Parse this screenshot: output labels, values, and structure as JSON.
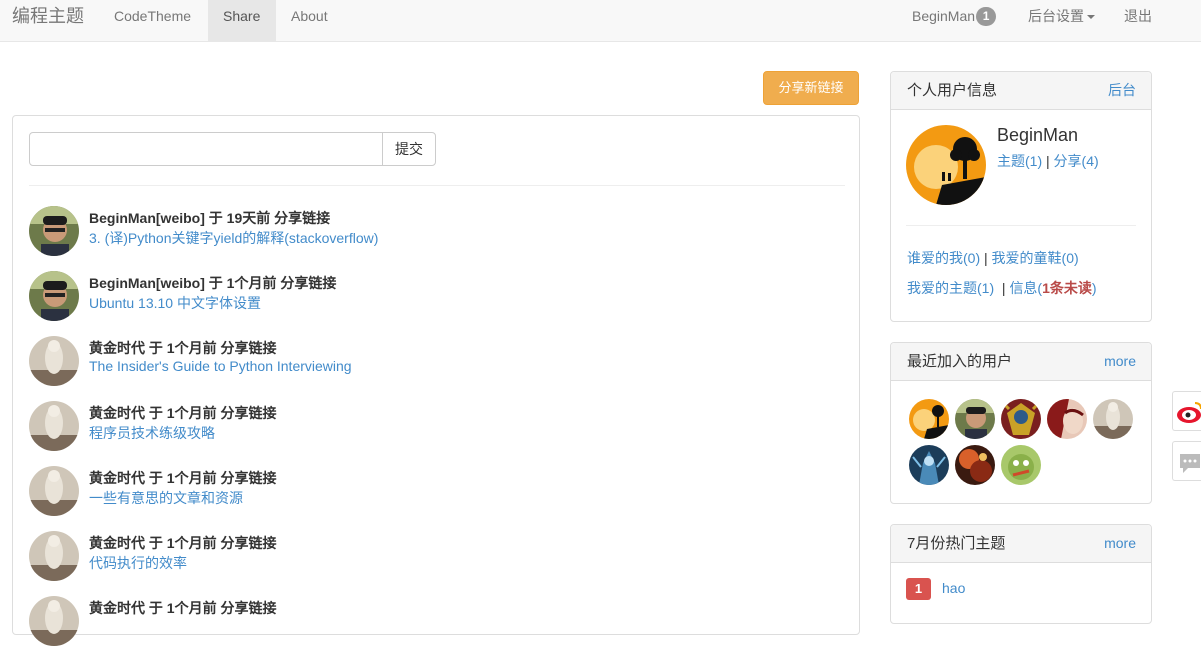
{
  "nav": {
    "brand": "编程主题",
    "items": [
      {
        "label": "CodeTheme",
        "active": false
      },
      {
        "label": "Share",
        "active": true
      },
      {
        "label": "About",
        "active": false
      }
    ],
    "user": "BeginMan",
    "user_badge": "1",
    "admin_settings": "后台设置",
    "logout": "退出"
  },
  "main": {
    "share_button": "分享新链接",
    "submit_button": "提交",
    "shares": [
      {
        "meta": "BeginMan[weibo] 于 19天前 分享链接",
        "title": "3. (译)Python关键字yield的解释(stackoverflow)",
        "avatar": "man"
      },
      {
        "meta": "BeginMan[weibo] 于 1个月前 分享链接",
        "title": "Ubuntu 13.10 中文字体设置",
        "avatar": "man"
      },
      {
        "meta": "黄金时代 于 1个月前 分享链接",
        "title": "The Insider's Guide to Python Interviewing",
        "avatar": "statue"
      },
      {
        "meta": "黄金时代 于 1个月前 分享链接",
        "title": "程序员技术练级攻略",
        "avatar": "statue"
      },
      {
        "meta": "黄金时代 于 1个月前 分享链接",
        "title": "一些有意思的文章和资源",
        "avatar": "statue"
      },
      {
        "meta": "黄金时代 于 1个月前 分享链接",
        "title": "代码执行的效率",
        "avatar": "statue"
      },
      {
        "meta": "黄金时代 于 1个月前 分享链接",
        "title": "",
        "avatar": "statue"
      }
    ]
  },
  "profile": {
    "title": "个人用户信息",
    "admin_link": "后台",
    "name": "BeginMan",
    "topics": "主题(1)",
    "sep": "|",
    "shares": "分享(4)",
    "who_loves_me": "谁爱的我(0)",
    "my_loves": "我爱的童鞋(0)",
    "my_fav_topics": "我爱的主题(1)",
    "messages_prefix": "信息(",
    "unread": "1条未读",
    "messages_suffix": ")"
  },
  "recent_users": {
    "title": "最近加入的用户",
    "more": "more"
  },
  "hot_topics": {
    "title": "7月份热门主题",
    "more": "more",
    "items": [
      {
        "rank": "1",
        "title": "hao"
      }
    ]
  },
  "colors": {
    "accent": "#428bca",
    "warning": "#f0ad4e",
    "danger": "#d9534f"
  }
}
